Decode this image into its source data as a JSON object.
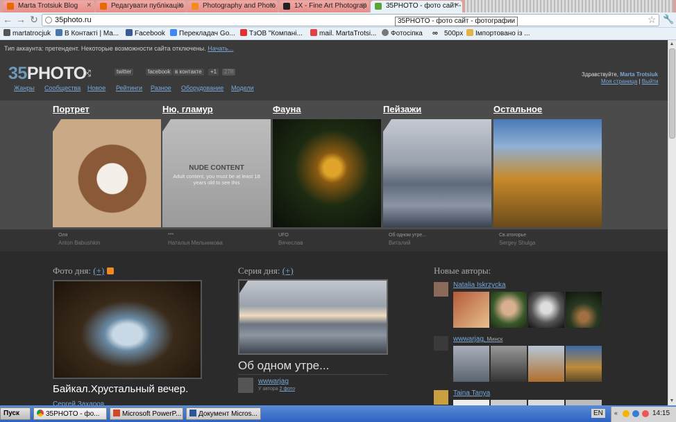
{
  "browser": {
    "tabs": [
      {
        "title": "Marta Trotsiuk Blog",
        "favicon_color": "#e76a00"
      },
      {
        "title": "Редагувати публікацію",
        "favicon_color": "#e76a00"
      },
      {
        "title": "Photography and Photo",
        "favicon_color": "#f28c1e"
      },
      {
        "title": "1X - Fine Art Photograp",
        "favicon_color": "#222222"
      },
      {
        "title": "35PHOTO - фото сайт -",
        "favicon_color": "#5aa33a"
      }
    ],
    "tooltip": "35PHOTO - фото сайт - фотографии",
    "url": "35photo.ru",
    "bookmarks": [
      {
        "label": "martatrocjuk",
        "icon": "person-icon",
        "color": "#555555"
      },
      {
        "label": "В Контакті | Ма...",
        "icon": "vk-icon",
        "color": "#4a76a8"
      },
      {
        "label": "Facebook",
        "icon": "facebook-icon",
        "color": "#3b5998"
      },
      {
        "label": "Перекладач Go...",
        "icon": "translate-icon",
        "color": "#4285f4"
      },
      {
        "label": "ТзОВ \"Компані...",
        "icon": "company-icon",
        "color": "#d33"
      },
      {
        "label": "mail. MartaTrotsi...",
        "icon": "mail-icon",
        "color": "#d44"
      },
      {
        "label": "Фотосіпка",
        "icon": "photo-icon",
        "color": "#777"
      },
      {
        "label": "500px",
        "icon": "infinity-icon",
        "color": "#111"
      },
      {
        "label": "Імпортовано із ...",
        "icon": "folder-icon",
        "color": "#e2b34a"
      }
    ]
  },
  "site": {
    "notice": "Тип аккаунта: претендент. Некоторые возможности сайта отключены.",
    "notice_link": "Начать...",
    "logo_mark": "35",
    "logo_text": "PHOTO",
    "social": [
      {
        "label": "twitter"
      },
      {
        "label": "facebook"
      },
      {
        "label": "в контакте"
      },
      {
        "label": "+1"
      },
      {
        "label": "278"
      }
    ],
    "nav": [
      "Жанры",
      "Сообщества",
      "Новое",
      "Рейтинги",
      "Разное",
      "Оборудование",
      "Модели"
    ],
    "greeting": "Здравствуйте,",
    "username": "Marta Trotsiuk",
    "my_page": "Моя страница",
    "separator": "|",
    "logout": "Выйти",
    "categories": [
      {
        "name": "Портрет",
        "caption_title": "Оля",
        "caption_author": "Anton Babushkin"
      },
      {
        "name": "Ню, гламур",
        "caption_title": "***",
        "caption_author": "Наталья Мельникова",
        "nude_title": "NUDE CONTENT",
        "nude_text": "Adult content, you must be at least 18 years old to see this"
      },
      {
        "name": "Фауна",
        "caption_title": "UFO",
        "caption_author": "Вячеслав"
      },
      {
        "name": "Пейзажи",
        "caption_title": "Об одном утре...",
        "caption_author": "Виталий"
      },
      {
        "name": "Остальное",
        "caption_title": "Св.атогорье",
        "caption_author": "Sergey Shulga"
      }
    ],
    "photo_day": {
      "heading": "Фото дня:",
      "plus": "(+)",
      "title": "Байкал.Хрустальный вечер.",
      "author": "Сергей Захаров"
    },
    "series_day": {
      "heading": "Серия дня:",
      "plus": "(+)",
      "title": "Об одном утре...",
      "author": "wwwarjag",
      "meta_prefix": "У автора",
      "meta_link": "2 фото"
    },
    "new_authors": {
      "heading": "Новые авторы:",
      "authors": [
        {
          "name": "Natalia Iskrzycka",
          "city": ""
        },
        {
          "name": "wwwarjag",
          "city": ", Минск"
        },
        {
          "name": "Taina Tanya",
          "city": ""
        }
      ]
    }
  },
  "taskbar": {
    "start": "Пуск",
    "tasks": [
      "35PHOTO - фо...",
      "Microsoft PowerP...",
      "Документ Micros..."
    ],
    "lang": "EN",
    "clock": "14:15"
  }
}
